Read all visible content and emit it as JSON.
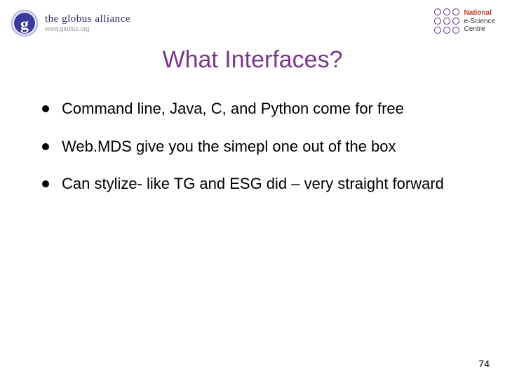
{
  "header": {
    "globus": {
      "name": "the globus alliance",
      "url": "www.globus.org"
    },
    "nesc": {
      "line1": "National",
      "line2": "e-Science",
      "line3": "Centre"
    }
  },
  "title": "What Interfaces?",
  "bullets": [
    "Command line, Java, C, and Python come for free",
    "Web.MDS give you the simepl one out of the box",
    "Can stylize- like TG and ESG did – very straight forward"
  ],
  "page_number": "74"
}
